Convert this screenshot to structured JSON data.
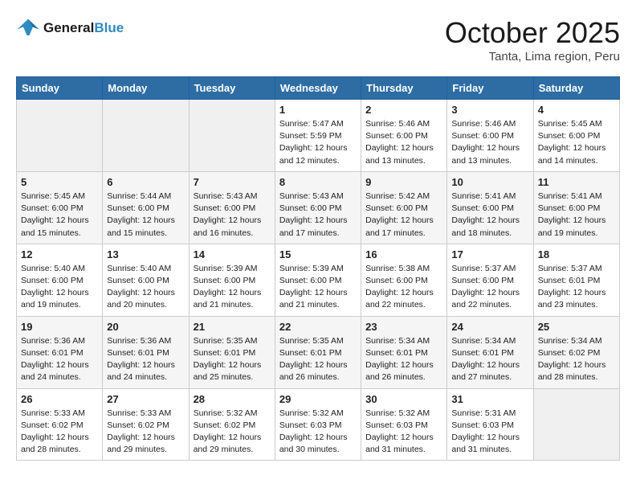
{
  "header": {
    "logo_line1": "General",
    "logo_line2": "Blue",
    "month": "October 2025",
    "location": "Tanta, Lima region, Peru"
  },
  "weekdays": [
    "Sunday",
    "Monday",
    "Tuesday",
    "Wednesday",
    "Thursday",
    "Friday",
    "Saturday"
  ],
  "weeks": [
    [
      {
        "day": "",
        "info": ""
      },
      {
        "day": "",
        "info": ""
      },
      {
        "day": "",
        "info": ""
      },
      {
        "day": "1",
        "info": "Sunrise: 5:47 AM\nSunset: 5:59 PM\nDaylight: 12 hours and 12 minutes."
      },
      {
        "day": "2",
        "info": "Sunrise: 5:46 AM\nSunset: 6:00 PM\nDaylight: 12 hours and 13 minutes."
      },
      {
        "day": "3",
        "info": "Sunrise: 5:46 AM\nSunset: 6:00 PM\nDaylight: 12 hours and 13 minutes."
      },
      {
        "day": "4",
        "info": "Sunrise: 5:45 AM\nSunset: 6:00 PM\nDaylight: 12 hours and 14 minutes."
      }
    ],
    [
      {
        "day": "5",
        "info": "Sunrise: 5:45 AM\nSunset: 6:00 PM\nDaylight: 12 hours and 15 minutes."
      },
      {
        "day": "6",
        "info": "Sunrise: 5:44 AM\nSunset: 6:00 PM\nDaylight: 12 hours and 15 minutes."
      },
      {
        "day": "7",
        "info": "Sunrise: 5:43 AM\nSunset: 6:00 PM\nDaylight: 12 hours and 16 minutes."
      },
      {
        "day": "8",
        "info": "Sunrise: 5:43 AM\nSunset: 6:00 PM\nDaylight: 12 hours and 17 minutes."
      },
      {
        "day": "9",
        "info": "Sunrise: 5:42 AM\nSunset: 6:00 PM\nDaylight: 12 hours and 17 minutes."
      },
      {
        "day": "10",
        "info": "Sunrise: 5:41 AM\nSunset: 6:00 PM\nDaylight: 12 hours and 18 minutes."
      },
      {
        "day": "11",
        "info": "Sunrise: 5:41 AM\nSunset: 6:00 PM\nDaylight: 12 hours and 19 minutes."
      }
    ],
    [
      {
        "day": "12",
        "info": "Sunrise: 5:40 AM\nSunset: 6:00 PM\nDaylight: 12 hours and 19 minutes."
      },
      {
        "day": "13",
        "info": "Sunrise: 5:40 AM\nSunset: 6:00 PM\nDaylight: 12 hours and 20 minutes."
      },
      {
        "day": "14",
        "info": "Sunrise: 5:39 AM\nSunset: 6:00 PM\nDaylight: 12 hours and 21 minutes."
      },
      {
        "day": "15",
        "info": "Sunrise: 5:39 AM\nSunset: 6:00 PM\nDaylight: 12 hours and 21 minutes."
      },
      {
        "day": "16",
        "info": "Sunrise: 5:38 AM\nSunset: 6:00 PM\nDaylight: 12 hours and 22 minutes."
      },
      {
        "day": "17",
        "info": "Sunrise: 5:37 AM\nSunset: 6:00 PM\nDaylight: 12 hours and 22 minutes."
      },
      {
        "day": "18",
        "info": "Sunrise: 5:37 AM\nSunset: 6:01 PM\nDaylight: 12 hours and 23 minutes."
      }
    ],
    [
      {
        "day": "19",
        "info": "Sunrise: 5:36 AM\nSunset: 6:01 PM\nDaylight: 12 hours and 24 minutes."
      },
      {
        "day": "20",
        "info": "Sunrise: 5:36 AM\nSunset: 6:01 PM\nDaylight: 12 hours and 24 minutes."
      },
      {
        "day": "21",
        "info": "Sunrise: 5:35 AM\nSunset: 6:01 PM\nDaylight: 12 hours and 25 minutes."
      },
      {
        "day": "22",
        "info": "Sunrise: 5:35 AM\nSunset: 6:01 PM\nDaylight: 12 hours and 26 minutes."
      },
      {
        "day": "23",
        "info": "Sunrise: 5:34 AM\nSunset: 6:01 PM\nDaylight: 12 hours and 26 minutes."
      },
      {
        "day": "24",
        "info": "Sunrise: 5:34 AM\nSunset: 6:01 PM\nDaylight: 12 hours and 27 minutes."
      },
      {
        "day": "25",
        "info": "Sunrise: 5:34 AM\nSunset: 6:02 PM\nDaylight: 12 hours and 28 minutes."
      }
    ],
    [
      {
        "day": "26",
        "info": "Sunrise: 5:33 AM\nSunset: 6:02 PM\nDaylight: 12 hours and 28 minutes."
      },
      {
        "day": "27",
        "info": "Sunrise: 5:33 AM\nSunset: 6:02 PM\nDaylight: 12 hours and 29 minutes."
      },
      {
        "day": "28",
        "info": "Sunrise: 5:32 AM\nSunset: 6:02 PM\nDaylight: 12 hours and 29 minutes."
      },
      {
        "day": "29",
        "info": "Sunrise: 5:32 AM\nSunset: 6:03 PM\nDaylight: 12 hours and 30 minutes."
      },
      {
        "day": "30",
        "info": "Sunrise: 5:32 AM\nSunset: 6:03 PM\nDaylight: 12 hours and 31 minutes."
      },
      {
        "day": "31",
        "info": "Sunrise: 5:31 AM\nSunset: 6:03 PM\nDaylight: 12 hours and 31 minutes."
      },
      {
        "day": "",
        "info": ""
      }
    ]
  ]
}
